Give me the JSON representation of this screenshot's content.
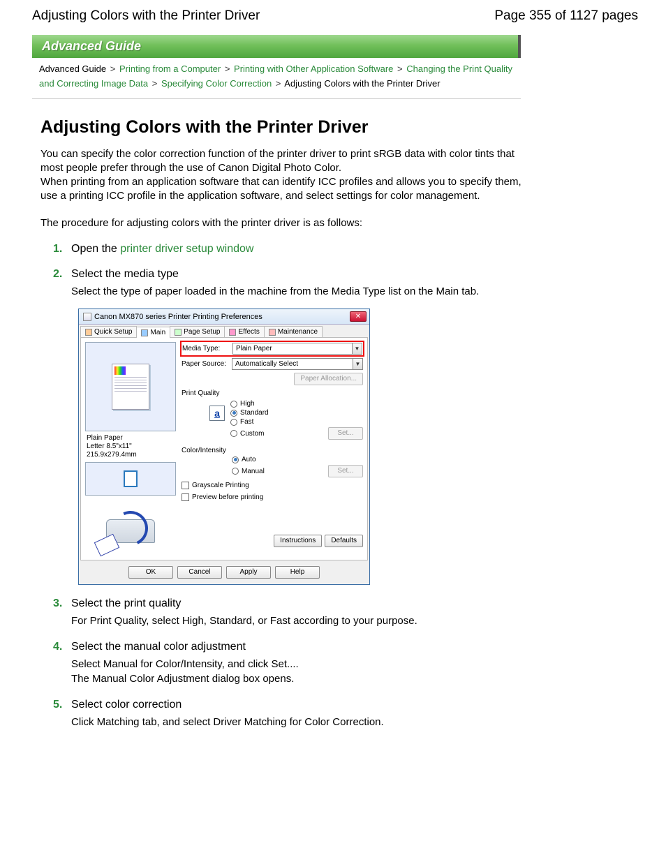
{
  "header": {
    "title": "Adjusting Colors with the Printer Driver",
    "page_indicator": "Page 355 of 1127 pages"
  },
  "banner": "Advanced Guide",
  "breadcrumb": {
    "items": [
      {
        "label": "Advanced Guide",
        "link": false
      },
      {
        "label": "Printing from a Computer",
        "link": true
      },
      {
        "label": "Printing with Other Application Software",
        "link": true
      },
      {
        "label": "Changing the Print Quality and Correcting Image Data",
        "link": true
      },
      {
        "label": "Specifying Color Correction",
        "link": true
      },
      {
        "label": "Adjusting Colors with the Printer Driver",
        "link": false
      }
    ],
    "sep": ">"
  },
  "article": {
    "title": "Adjusting Colors with the Printer Driver",
    "intro_p1": "You can specify the color correction function of the printer driver to print sRGB data with color tints that most people prefer through the use of Canon Digital Photo Color.",
    "intro_p2": "When printing from an application software that can identify ICC profiles and allows you to specify them, use a printing ICC profile in the application software, and select settings for color management.",
    "intro_p3": "The procedure for adjusting colors with the printer driver is as follows:"
  },
  "steps": [
    {
      "num": "1.",
      "prefix": "Open the ",
      "link": "printer driver setup window",
      "body": ""
    },
    {
      "num": "2.",
      "title": "Select the media type",
      "body": "Select the type of paper loaded in the machine from the Media Type list on the Main tab."
    },
    {
      "num": "3.",
      "title": "Select the print quality",
      "body": "For Print Quality, select High, Standard, or Fast according to your purpose."
    },
    {
      "num": "4.",
      "title": "Select the manual color adjustment",
      "body": "Select Manual for Color/Intensity, and click Set....\nThe Manual Color Adjustment dialog box opens."
    },
    {
      "num": "5.",
      "title": "Select color correction",
      "body": "Click Matching tab, and select Driver Matching for Color Correction."
    }
  ],
  "dialog": {
    "title": "Canon MX870 series Printer Printing Preferences",
    "close": "✕",
    "tabs": [
      "Quick Setup",
      "Main",
      "Page Setup",
      "Effects",
      "Maintenance"
    ],
    "media_type_label": "Media Type:",
    "media_type_value": "Plain Paper",
    "paper_source_label": "Paper Source:",
    "paper_source_value": "Automatically Select",
    "paper_allocation_btn": "Paper Allocation...",
    "print_quality_label": "Print Quality",
    "pq_options": [
      "High",
      "Standard",
      "Fast",
      "Custom"
    ],
    "pq_set_btn": "Set...",
    "color_intensity_label": "Color/Intensity",
    "ci_options": [
      "Auto",
      "Manual"
    ],
    "ci_set_btn": "Set...",
    "grayscale_label": "Grayscale Printing",
    "preview_label": "Preview before printing",
    "instructions_btn": "Instructions",
    "defaults_btn": "Defaults",
    "ok_btn": "OK",
    "cancel_btn": "Cancel",
    "apply_btn": "Apply",
    "help_btn": "Help",
    "left_media_caption1": "Plain Paper",
    "left_media_caption2": "Letter 8.5\"x11\" 215.9x279.4mm"
  }
}
